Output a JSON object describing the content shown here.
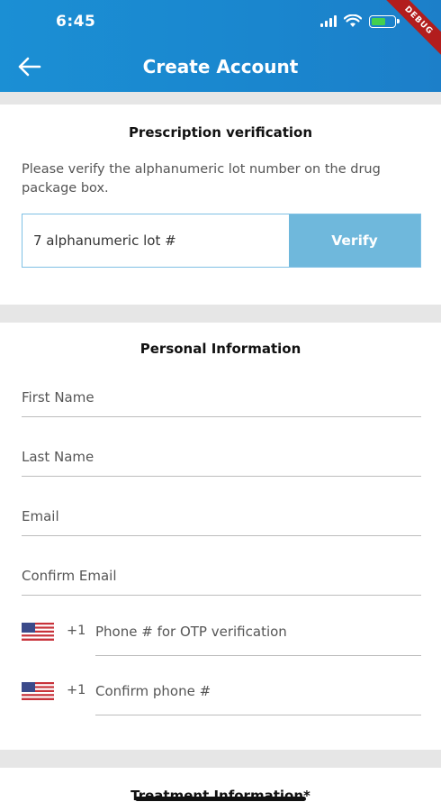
{
  "status_bar": {
    "time": "6:45",
    "debug_label": "DEBUG",
    "battery_color": "#44d04f"
  },
  "header": {
    "title": "Create Account",
    "back_icon": "arrow-left-icon",
    "background": "#1a86ce"
  },
  "prescription": {
    "title": "Prescription verification",
    "description": "Please verify the alphanumeric lot number on the drug package box.",
    "lot_placeholder": "7 alphanumeric lot #",
    "verify_label": "Verify",
    "verify_color": "#6fb8dc"
  },
  "personal": {
    "title": "Personal Information",
    "first_name_placeholder": "First Name",
    "last_name_placeholder": "Last Name",
    "email_placeholder": "Email",
    "confirm_email_placeholder": "Confirm Email",
    "phone_country_code": "+1",
    "phone_placeholder": "Phone # for OTP verification",
    "confirm_phone_country_code": "+1",
    "confirm_phone_placeholder": "Confirm phone #",
    "flag_icon": "us-flag-icon"
  },
  "treatment": {
    "title": "Treatment Information*"
  }
}
